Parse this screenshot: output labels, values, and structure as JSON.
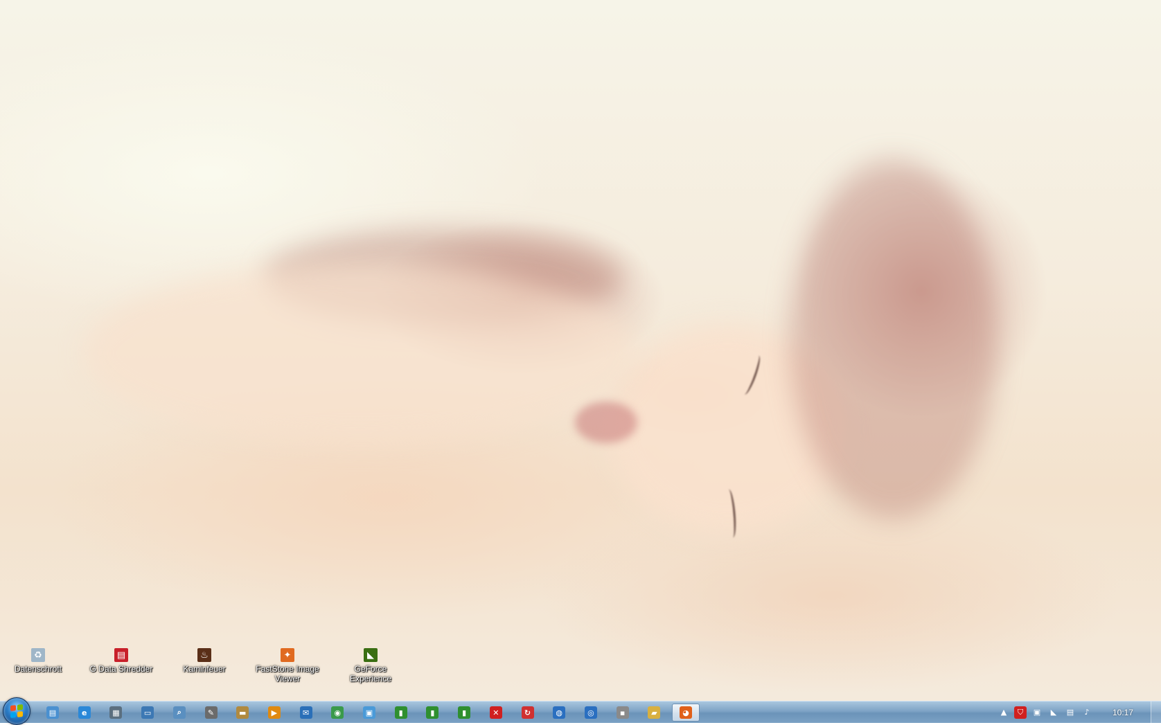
{
  "desktop": {
    "icons": [
      {
        "label": "Datenschrott",
        "icon": "recycle-bin-icon",
        "color": "#9fb6c8"
      },
      {
        "label": "G Data Shredder",
        "icon": "shredder-icon",
        "color": "#c8202a"
      },
      {
        "label": "Kaminfeuer",
        "icon": "fireplace-icon",
        "color": "#5a2f18"
      },
      {
        "label": "FastStone Image Viewer",
        "icon": "faststone-icon",
        "color": "#e06a20"
      },
      {
        "label": "GeForce Experience",
        "icon": "nvidia-icon",
        "color": "#3a6e12"
      }
    ]
  },
  "taskbar": {
    "start": "start-orb",
    "pinned": [
      {
        "icon": "explorer-icon",
        "color": "#4a90d0",
        "glyph": "▤"
      },
      {
        "icon": "internet-explorer-icon",
        "color": "#2a88d8",
        "glyph": "e"
      },
      {
        "icon": "calculator-icon",
        "color": "#5b6f7f",
        "glyph": "▦"
      },
      {
        "icon": "drive-icon",
        "color": "#3c78b4",
        "glyph": "▭"
      },
      {
        "icon": "search-icon",
        "color": "#5a8fc0",
        "glyph": "⌕"
      },
      {
        "icon": "paint-icon",
        "color": "#6b6b6b",
        "glyph": "✎"
      },
      {
        "icon": "scanner-icon",
        "color": "#b08a40",
        "glyph": "▬"
      },
      {
        "icon": "media-player-icon",
        "color": "#e08a10",
        "glyph": "▶"
      },
      {
        "icon": "mail-icon",
        "color": "#2a6fb8",
        "glyph": "✉"
      },
      {
        "icon": "maps-icon",
        "color": "#3a9a4a",
        "glyph": "◉"
      },
      {
        "icon": "photos-icon",
        "color": "#4a9ad8",
        "glyph": "▣"
      },
      {
        "icon": "green-app-1-icon",
        "color": "#2f8f2f",
        "glyph": "▮"
      },
      {
        "icon": "green-app-2-icon",
        "color": "#2f8f2f",
        "glyph": "▮"
      },
      {
        "icon": "green-app-3-icon",
        "color": "#2f8f2f",
        "glyph": "▮"
      },
      {
        "icon": "close-app-icon",
        "color": "#d02020",
        "glyph": "✕"
      },
      {
        "icon": "sync-icon",
        "color": "#d03030",
        "glyph": "↻"
      },
      {
        "icon": "network-globe-icon",
        "color": "#2a6fc0",
        "glyph": "◍"
      },
      {
        "icon": "globe-icon",
        "color": "#2a6fc0",
        "glyph": "◎"
      },
      {
        "icon": "camera-icon",
        "color": "#8a8a8a",
        "glyph": "▪"
      },
      {
        "icon": "folder-icon",
        "color": "#d8b040",
        "glyph": "▰"
      },
      {
        "icon": "firefox-icon",
        "color": "#e0601a",
        "glyph": "◕",
        "active": true
      }
    ],
    "tray": [
      {
        "icon": "show-hidden-icons-icon",
        "glyph": "▲"
      },
      {
        "icon": "gdata-shield-icon",
        "glyph": "⛉",
        "color": "#d02020"
      },
      {
        "icon": "monitor-icon",
        "glyph": "▣"
      },
      {
        "icon": "nvidia-tray-icon",
        "glyph": "◣"
      },
      {
        "icon": "network-icon",
        "glyph": "▤"
      },
      {
        "icon": "volume-icon",
        "glyph": "♪"
      }
    ],
    "clock": "10:17"
  }
}
